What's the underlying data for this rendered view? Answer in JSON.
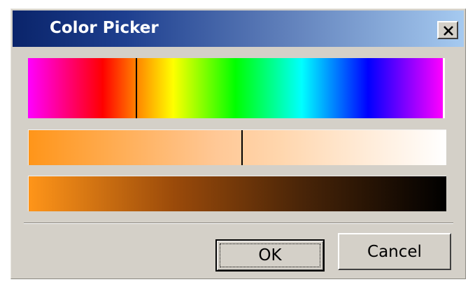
{
  "window": {
    "title": "Color Picker",
    "close_icon": "close-icon"
  },
  "sliders": {
    "hue": {
      "value_fraction": 0.26
    },
    "saturation": {
      "value_fraction": 0.51
    },
    "value": {
      "value_fraction": null
    }
  },
  "buttons": {
    "ok_label": "OK",
    "cancel_label": "Cancel"
  },
  "colors": {
    "titlebar_start": "#0a246a",
    "titlebar_end": "#a6caf0",
    "dialog_bg": "#d4d0c8",
    "selected_color": "#ff9519"
  }
}
